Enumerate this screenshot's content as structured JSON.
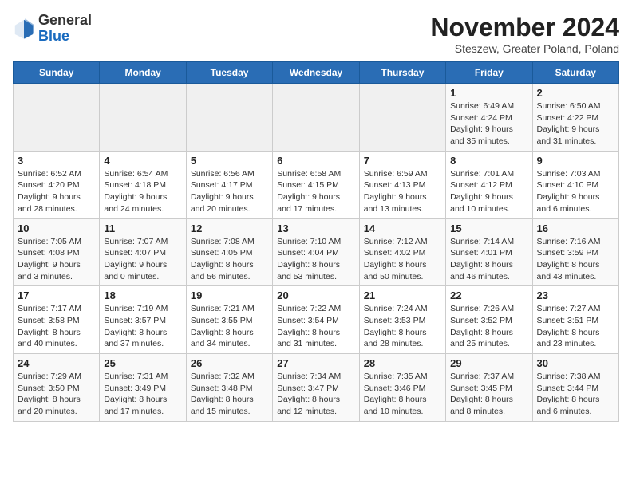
{
  "header": {
    "logo_general": "General",
    "logo_blue": "Blue",
    "month_title": "November 2024",
    "subtitle": "Steszew, Greater Poland, Poland"
  },
  "days_of_week": [
    "Sunday",
    "Monday",
    "Tuesday",
    "Wednesday",
    "Thursday",
    "Friday",
    "Saturday"
  ],
  "weeks": [
    [
      {
        "day": "",
        "info": ""
      },
      {
        "day": "",
        "info": ""
      },
      {
        "day": "",
        "info": ""
      },
      {
        "day": "",
        "info": ""
      },
      {
        "day": "",
        "info": ""
      },
      {
        "day": "1",
        "info": "Sunrise: 6:49 AM\nSunset: 4:24 PM\nDaylight: 9 hours and 35 minutes."
      },
      {
        "day": "2",
        "info": "Sunrise: 6:50 AM\nSunset: 4:22 PM\nDaylight: 9 hours and 31 minutes."
      }
    ],
    [
      {
        "day": "3",
        "info": "Sunrise: 6:52 AM\nSunset: 4:20 PM\nDaylight: 9 hours and 28 minutes."
      },
      {
        "day": "4",
        "info": "Sunrise: 6:54 AM\nSunset: 4:18 PM\nDaylight: 9 hours and 24 minutes."
      },
      {
        "day": "5",
        "info": "Sunrise: 6:56 AM\nSunset: 4:17 PM\nDaylight: 9 hours and 20 minutes."
      },
      {
        "day": "6",
        "info": "Sunrise: 6:58 AM\nSunset: 4:15 PM\nDaylight: 9 hours and 17 minutes."
      },
      {
        "day": "7",
        "info": "Sunrise: 6:59 AM\nSunset: 4:13 PM\nDaylight: 9 hours and 13 minutes."
      },
      {
        "day": "8",
        "info": "Sunrise: 7:01 AM\nSunset: 4:12 PM\nDaylight: 9 hours and 10 minutes."
      },
      {
        "day": "9",
        "info": "Sunrise: 7:03 AM\nSunset: 4:10 PM\nDaylight: 9 hours and 6 minutes."
      }
    ],
    [
      {
        "day": "10",
        "info": "Sunrise: 7:05 AM\nSunset: 4:08 PM\nDaylight: 9 hours and 3 minutes."
      },
      {
        "day": "11",
        "info": "Sunrise: 7:07 AM\nSunset: 4:07 PM\nDaylight: 9 hours and 0 minutes."
      },
      {
        "day": "12",
        "info": "Sunrise: 7:08 AM\nSunset: 4:05 PM\nDaylight: 8 hours and 56 minutes."
      },
      {
        "day": "13",
        "info": "Sunrise: 7:10 AM\nSunset: 4:04 PM\nDaylight: 8 hours and 53 minutes."
      },
      {
        "day": "14",
        "info": "Sunrise: 7:12 AM\nSunset: 4:02 PM\nDaylight: 8 hours and 50 minutes."
      },
      {
        "day": "15",
        "info": "Sunrise: 7:14 AM\nSunset: 4:01 PM\nDaylight: 8 hours and 46 minutes."
      },
      {
        "day": "16",
        "info": "Sunrise: 7:16 AM\nSunset: 3:59 PM\nDaylight: 8 hours and 43 minutes."
      }
    ],
    [
      {
        "day": "17",
        "info": "Sunrise: 7:17 AM\nSunset: 3:58 PM\nDaylight: 8 hours and 40 minutes."
      },
      {
        "day": "18",
        "info": "Sunrise: 7:19 AM\nSunset: 3:57 PM\nDaylight: 8 hours and 37 minutes."
      },
      {
        "day": "19",
        "info": "Sunrise: 7:21 AM\nSunset: 3:55 PM\nDaylight: 8 hours and 34 minutes."
      },
      {
        "day": "20",
        "info": "Sunrise: 7:22 AM\nSunset: 3:54 PM\nDaylight: 8 hours and 31 minutes."
      },
      {
        "day": "21",
        "info": "Sunrise: 7:24 AM\nSunset: 3:53 PM\nDaylight: 8 hours and 28 minutes."
      },
      {
        "day": "22",
        "info": "Sunrise: 7:26 AM\nSunset: 3:52 PM\nDaylight: 8 hours and 25 minutes."
      },
      {
        "day": "23",
        "info": "Sunrise: 7:27 AM\nSunset: 3:51 PM\nDaylight: 8 hours and 23 minutes."
      }
    ],
    [
      {
        "day": "24",
        "info": "Sunrise: 7:29 AM\nSunset: 3:50 PM\nDaylight: 8 hours and 20 minutes."
      },
      {
        "day": "25",
        "info": "Sunrise: 7:31 AM\nSunset: 3:49 PM\nDaylight: 8 hours and 17 minutes."
      },
      {
        "day": "26",
        "info": "Sunrise: 7:32 AM\nSunset: 3:48 PM\nDaylight: 8 hours and 15 minutes."
      },
      {
        "day": "27",
        "info": "Sunrise: 7:34 AM\nSunset: 3:47 PM\nDaylight: 8 hours and 12 minutes."
      },
      {
        "day": "28",
        "info": "Sunrise: 7:35 AM\nSunset: 3:46 PM\nDaylight: 8 hours and 10 minutes."
      },
      {
        "day": "29",
        "info": "Sunrise: 7:37 AM\nSunset: 3:45 PM\nDaylight: 8 hours and 8 minutes."
      },
      {
        "day": "30",
        "info": "Sunrise: 7:38 AM\nSunset: 3:44 PM\nDaylight: 8 hours and 6 minutes."
      }
    ]
  ]
}
